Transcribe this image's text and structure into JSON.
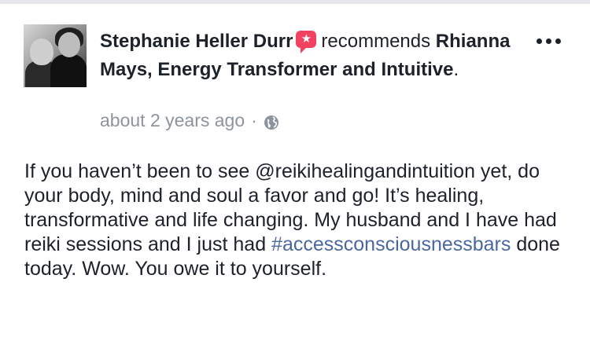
{
  "post": {
    "author": "Stephanie Heller Durr",
    "verb": "recommends",
    "page": "Rhianna Mays, Energy Transformer and Intuitive",
    "page_suffix": ".",
    "timestamp": "about 2 years ago",
    "meta_separator": "·",
    "privacy_icon": "globe-icon",
    "recommend_icon": "recommendation-star-icon",
    "body_part1": "If you haven’t been to see @reikihealingandintuition yet, do your body, mind and soul a favor and go! It’s healing, transformative and life changing. My husband and I have had reiki sessions and I just had ",
    "hashtag": "#accessconsciousnessbars",
    "body_part2": " done today. Wow. You owe it to yourself."
  },
  "colors": {
    "text": "#1d2129",
    "meta": "#8d949e",
    "link": "#4b67a1",
    "recommend": "#f3425f"
  }
}
